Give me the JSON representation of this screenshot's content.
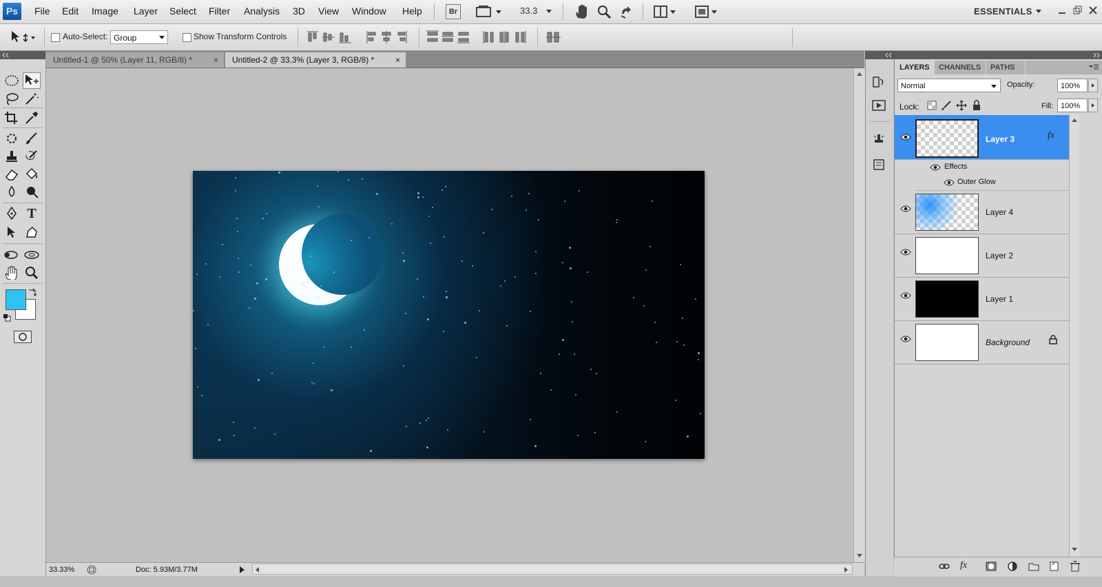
{
  "app": {
    "logo": "Ps",
    "workspace": "ESSENTIALS"
  },
  "menu": [
    "File",
    "Edit",
    "Image",
    "Layer",
    "Select",
    "Filter",
    "Analysis",
    "3D",
    "View",
    "Window",
    "Help"
  ],
  "appbar": {
    "bridge": "Br",
    "zoom": "33.3"
  },
  "options": {
    "auto_select": "Auto-Select:",
    "group_value": "Group",
    "show_transform": "Show Transform Controls"
  },
  "tabs": [
    {
      "label": "Untitled-1 @ 50% (Layer 11, RGB/8) *",
      "close": "×"
    },
    {
      "label": "Untitled-2 @ 33.3% (Layer 3, RGB/8) *",
      "close": "×"
    }
  ],
  "status": {
    "zoom": "33.33%",
    "doc": "Doc: 5.93M/3.77M"
  },
  "colors": {
    "foreground": "#2ec4f2",
    "background": "#ffffff",
    "selection": "#3a8ef0"
  },
  "layers_panel": {
    "tabs": [
      "LAYERS",
      "CHANNELS",
      "PATHS"
    ],
    "blend_mode": "Normal",
    "opacity_label": "Opacity:",
    "opacity": "100%",
    "lock_label": "Lock:",
    "fill_label": "Fill:",
    "fill": "100%",
    "effects_label": "Effects",
    "outer_glow_label": "Outer Glow",
    "fx": "fx",
    "layers": [
      {
        "name": "Layer 3",
        "selected": true
      },
      {
        "name": "Layer 4"
      },
      {
        "name": "Layer 2"
      },
      {
        "name": "Layer 1"
      },
      {
        "name": "Background",
        "locked": true
      }
    ]
  }
}
